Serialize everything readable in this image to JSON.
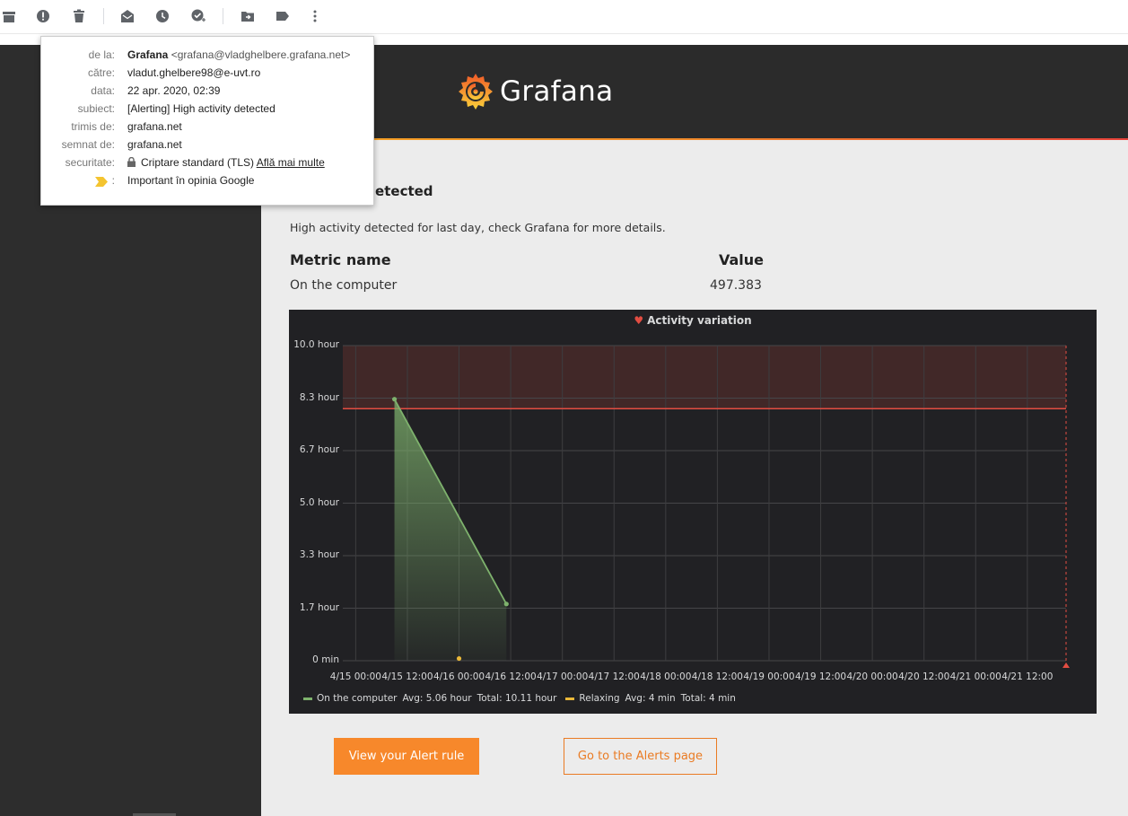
{
  "toolbar": {
    "icons": [
      "archive-icon",
      "report-spam-icon",
      "delete-icon",
      "mark-unread-icon",
      "snooze-icon",
      "add-task-icon",
      "move-to-icon",
      "label-icon",
      "more-vert-icon"
    ]
  },
  "popup": {
    "from_label": "de la:",
    "from_name": "Grafana",
    "from_email": "<grafana@vladghelbere.grafana.net>",
    "to_label": "către:",
    "to_value": "vladut.ghelbere98@e-uvt.ro",
    "date_label": "data:",
    "date_value": "22 apr. 2020, 02:39",
    "subject_label": "subiect:",
    "subject_value": "[Alerting] High activity detected",
    "mailed_by_label": "trimis de:",
    "mailed_by_value": "grafana.net",
    "signed_by_label": "semnat de:",
    "signed_by_value": "grafana.net",
    "security_label": "securitate:",
    "security_value": "Criptare standard (TLS)",
    "security_link": "Află mai multe",
    "important_label": ":",
    "important_value": "Important în opinia Google",
    "important_color": "#f4c430"
  },
  "email": {
    "brand": "Grafana",
    "alert_title": "h activity detected",
    "message": "High activity detected for last day, check Grafana for more details.",
    "metric_header": "Metric name",
    "value_header": "Value",
    "metric_name": "On the computer",
    "metric_value": "497.383",
    "button_primary": "View your Alert rule",
    "button_secondary": "Go to the Alerts page",
    "accent_color": "#f7882b"
  },
  "chart_data": {
    "type": "line",
    "title": "Activity variation",
    "y_ticks": [
      "10.0 hour",
      "8.3 hour",
      "6.7 hour",
      "5.0 hour",
      "3.3 hour",
      "1.7 hour",
      "0 min"
    ],
    "x_ticks": [
      "4/15 00:00",
      "4/15 12:00",
      "4/16 00:00",
      "4/16 12:00",
      "4/17 00:00",
      "4/17 12:00",
      "4/18 00:00",
      "4/18 12:00",
      "4/19 00:00",
      "4/19 12:00",
      "4/20 00:00",
      "4/20 12:00",
      "4/21 00:00",
      "4/21 12:00"
    ],
    "ylim_hours": [
      0,
      10
    ],
    "xlim": [
      "4/14 21:00",
      "4/21 21:00"
    ],
    "threshold_hours": 8.0,
    "threshold_color": "#e24d42",
    "series": [
      {
        "name": "On the computer",
        "color": "#7eb26d",
        "points": [
          [
            "4/15 09:00",
            8.3
          ],
          [
            "4/16 11:00",
            1.8
          ]
        ],
        "avg": "Avg: 5.06 hour",
        "total": "Total: 10.11 hour"
      },
      {
        "name": "Relaxing",
        "color": "#eab839",
        "points": [
          [
            "4/16 00:00",
            0.07
          ]
        ],
        "avg": "Avg: 4 min",
        "total": "Total: 4 min"
      }
    ],
    "grid": true,
    "legend": "bottom"
  }
}
